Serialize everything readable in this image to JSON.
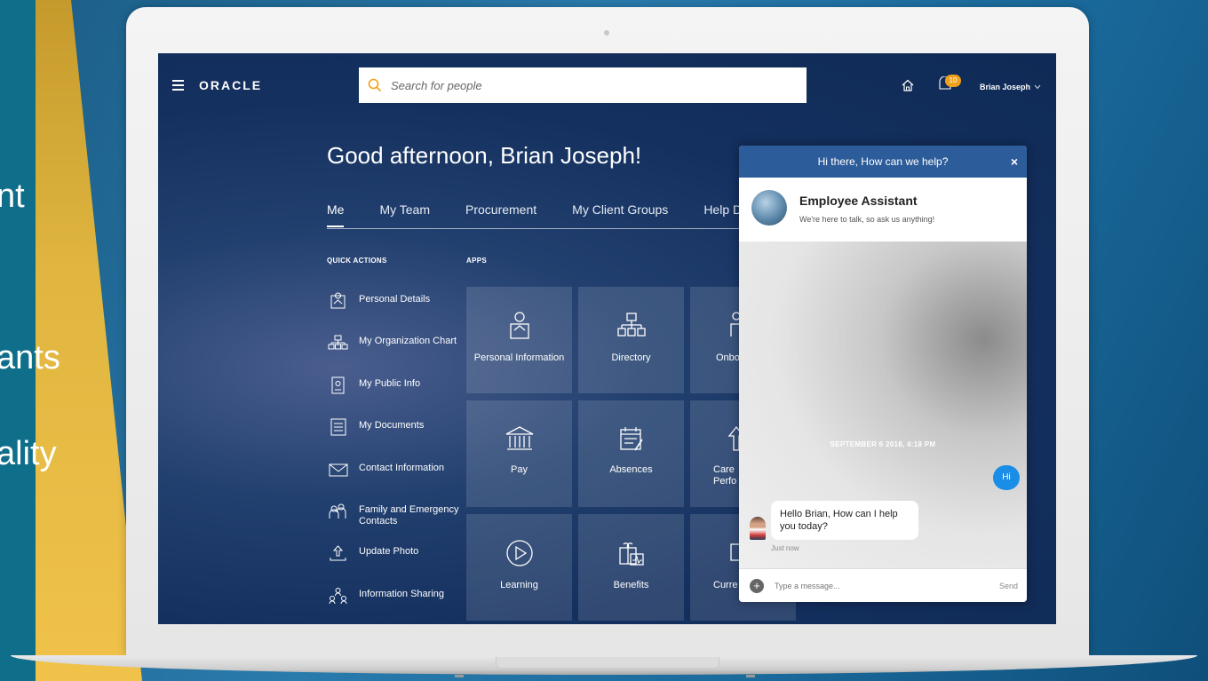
{
  "slide": {
    "lines": [
      "nt",
      "ants",
      "ality"
    ]
  },
  "header": {
    "logo": "ORACLE",
    "search_placeholder": "Search for people",
    "notification_count": "10",
    "user_name": "Brian Joseph"
  },
  "greeting": "Good afternoon, Brian Joseph!",
  "tabs": [
    "Me",
    "My Team",
    "Procurement",
    "My Client Groups",
    "Help D"
  ],
  "sections": {
    "quick_actions": "QUICK ACTIONS",
    "apps": "APPS"
  },
  "quick_actions": [
    {
      "label": "Personal Details",
      "icon": "person-id-icon"
    },
    {
      "label": "My Organization Chart",
      "icon": "org-chart-icon"
    },
    {
      "label": "My Public Info",
      "icon": "badge-icon"
    },
    {
      "label": "My Documents",
      "icon": "document-icon"
    },
    {
      "label": "Contact Information",
      "icon": "envelope-icon"
    },
    {
      "label": "Family and Emergency Contacts",
      "icon": "family-icon"
    },
    {
      "label": "Update Photo",
      "icon": "upload-photo-icon"
    },
    {
      "label": "Information Sharing",
      "icon": "sharing-icon"
    }
  ],
  "apps": [
    {
      "label": "Personal Information",
      "icon": "person-icon"
    },
    {
      "label": "Directory",
      "icon": "directory-icon"
    },
    {
      "label": "Onbo",
      "icon": "onboarding-icon"
    },
    {
      "label": "Pay",
      "icon": "bank-icon"
    },
    {
      "label": "Absences",
      "icon": "calendar-icon"
    },
    {
      "label": "Care Perfo",
      "icon": "career-icon"
    },
    {
      "label": "Learning",
      "icon": "play-icon"
    },
    {
      "label": "Benefits",
      "icon": "gift-icon"
    },
    {
      "label": "Curre",
      "icon": "current-icon"
    }
  ],
  "chat": {
    "header": "Hi there, How can we help?",
    "close": "×",
    "agent_name": "Employee Assistant",
    "agent_subtitle": "We're here to talk, so ask us anything!",
    "date": "SEPTEMBER 6 2018, 4:18 PM",
    "user_message": "Hi",
    "bot_message": "Hello Brian, How can I help you today?",
    "bot_time": "Just now",
    "input_placeholder": "Type a message...",
    "send_label": "Send"
  }
}
